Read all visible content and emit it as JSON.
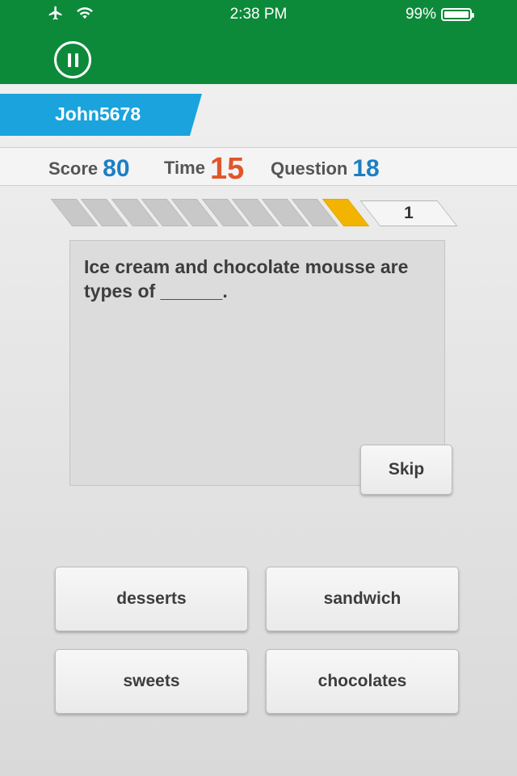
{
  "status_bar": {
    "time": "2:38 PM",
    "battery": "99%",
    "icons": [
      "airplane-icon",
      "wifi-icon",
      "battery-icon"
    ]
  },
  "header": {
    "pause_icon": "pause-icon",
    "color": "#0c8a3a"
  },
  "user": {
    "name": "John5678",
    "tab_color": "#1aa3dc"
  },
  "stats": {
    "score_label": "Score",
    "score_value": "80",
    "time_label": "Time",
    "time_value": "15",
    "question_label": "Question",
    "question_value": "18"
  },
  "progress": {
    "segments_total": 10,
    "active_segment": 10,
    "counter": "1"
  },
  "question": {
    "text": "Ice cream and chocolate mousse are types of ______."
  },
  "skip_label": "Skip",
  "answers": [
    "desserts",
    "sandwich",
    "sweets",
    "chocolates"
  ]
}
